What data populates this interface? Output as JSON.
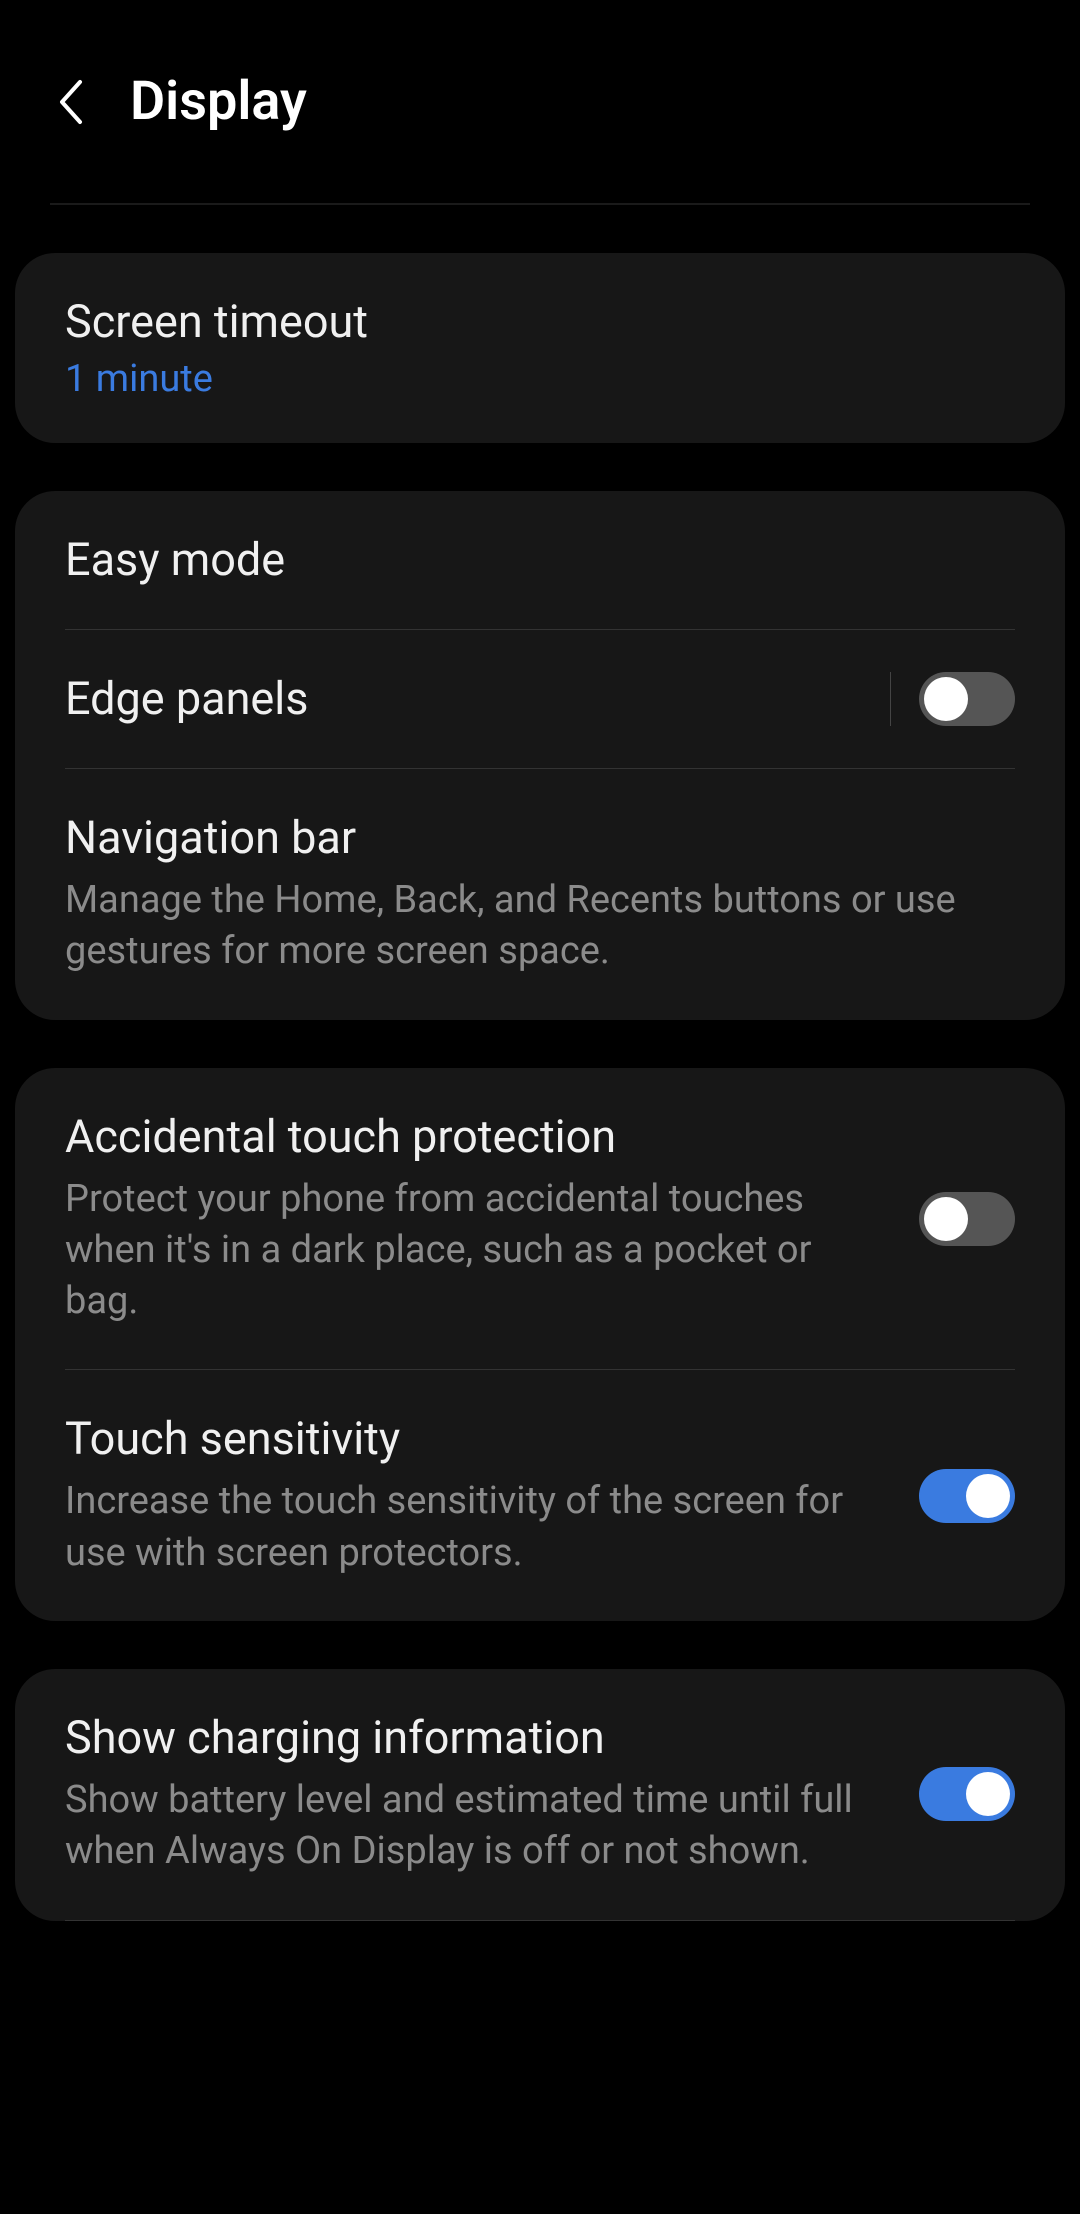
{
  "header": {
    "title": "Display"
  },
  "group1": {
    "screen_timeout": {
      "label": "Screen timeout",
      "value": "1 minute"
    }
  },
  "group2": {
    "easy_mode": {
      "label": "Easy mode"
    },
    "edge_panels": {
      "label": "Edge panels",
      "on": false
    },
    "navigation_bar": {
      "label": "Navigation bar",
      "description": "Manage the Home, Back, and Recents buttons or use gestures for more screen space."
    }
  },
  "group3": {
    "accidental_touch": {
      "label": "Accidental touch protection",
      "description": "Protect your phone from accidental touches when it's in a dark place, such as a pocket or bag.",
      "on": false
    },
    "touch_sensitivity": {
      "label": "Touch sensitivity",
      "description": "Increase the touch sensitivity of the screen for use with screen protectors.",
      "on": true
    }
  },
  "group4": {
    "charging_info": {
      "label": "Show charging information",
      "description": "Show battery level and estimated time until full when Always On Display is off or not shown.",
      "on": true
    }
  }
}
